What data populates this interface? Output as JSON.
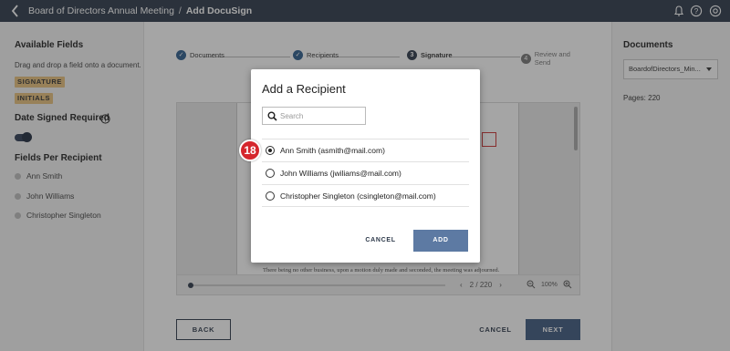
{
  "header": {
    "breadcrumb_parent": "Board of Directors Annual Meeting",
    "breadcrumb_separator": "/",
    "breadcrumb_current": "Add DocuSign",
    "icons": [
      "back-arrow-icon",
      "bell-icon",
      "help-icon",
      "settings-icon"
    ]
  },
  "left_panel": {
    "available_fields_title": "Available Fields",
    "available_fields_desc": "Drag and drop a field onto a document.",
    "fields": [
      "SIGNATURE",
      "INITIALS"
    ],
    "date_signed_label": "Date Signed Required",
    "date_signed_on": true,
    "fields_per_recipient_title": "Fields Per Recipient",
    "recipients": [
      "Ann Smith",
      "John Williams",
      "Christopher Singleton"
    ]
  },
  "steps": [
    {
      "num": "",
      "label": "Documents",
      "state": "done"
    },
    {
      "num": "",
      "label": "Recipients",
      "state": "done"
    },
    {
      "num": "3",
      "label": "Signature",
      "state": "current"
    },
    {
      "num": "4",
      "label": "Review and Send",
      "state": "todo"
    }
  ],
  "viewer": {
    "page_text": "There being no other business, upon a motion duly made and seconded, the meeting was adjourned.",
    "current_page": "2",
    "page_separator": "/",
    "total_pages": "220",
    "zoom": "100%"
  },
  "footer": {
    "back_label": "BACK",
    "cancel_label": "CANCEL",
    "next_label": "NEXT"
  },
  "right_panel": {
    "title": "Documents",
    "selected_document": "BoardofDirectors_Min...",
    "pages_text": "Pages: 220"
  },
  "modal": {
    "title": "Add a Recipient",
    "search_placeholder": "Search",
    "options": [
      {
        "label": "Ann Smith (asmith@mail.com)",
        "selected": true
      },
      {
        "label": "John Williams (jwiliams@mail.com)",
        "selected": false
      },
      {
        "label": "Christopher Singleton (csingleton@mail.com)",
        "selected": false
      }
    ],
    "cancel_label": "CANCEL",
    "add_label": "ADD"
  },
  "callout_marker": "18",
  "colors": {
    "topbar": "#2e3a4b",
    "primary_button": "#3e5a80",
    "tag": "#e8c27d",
    "marker": "#d5262d"
  }
}
